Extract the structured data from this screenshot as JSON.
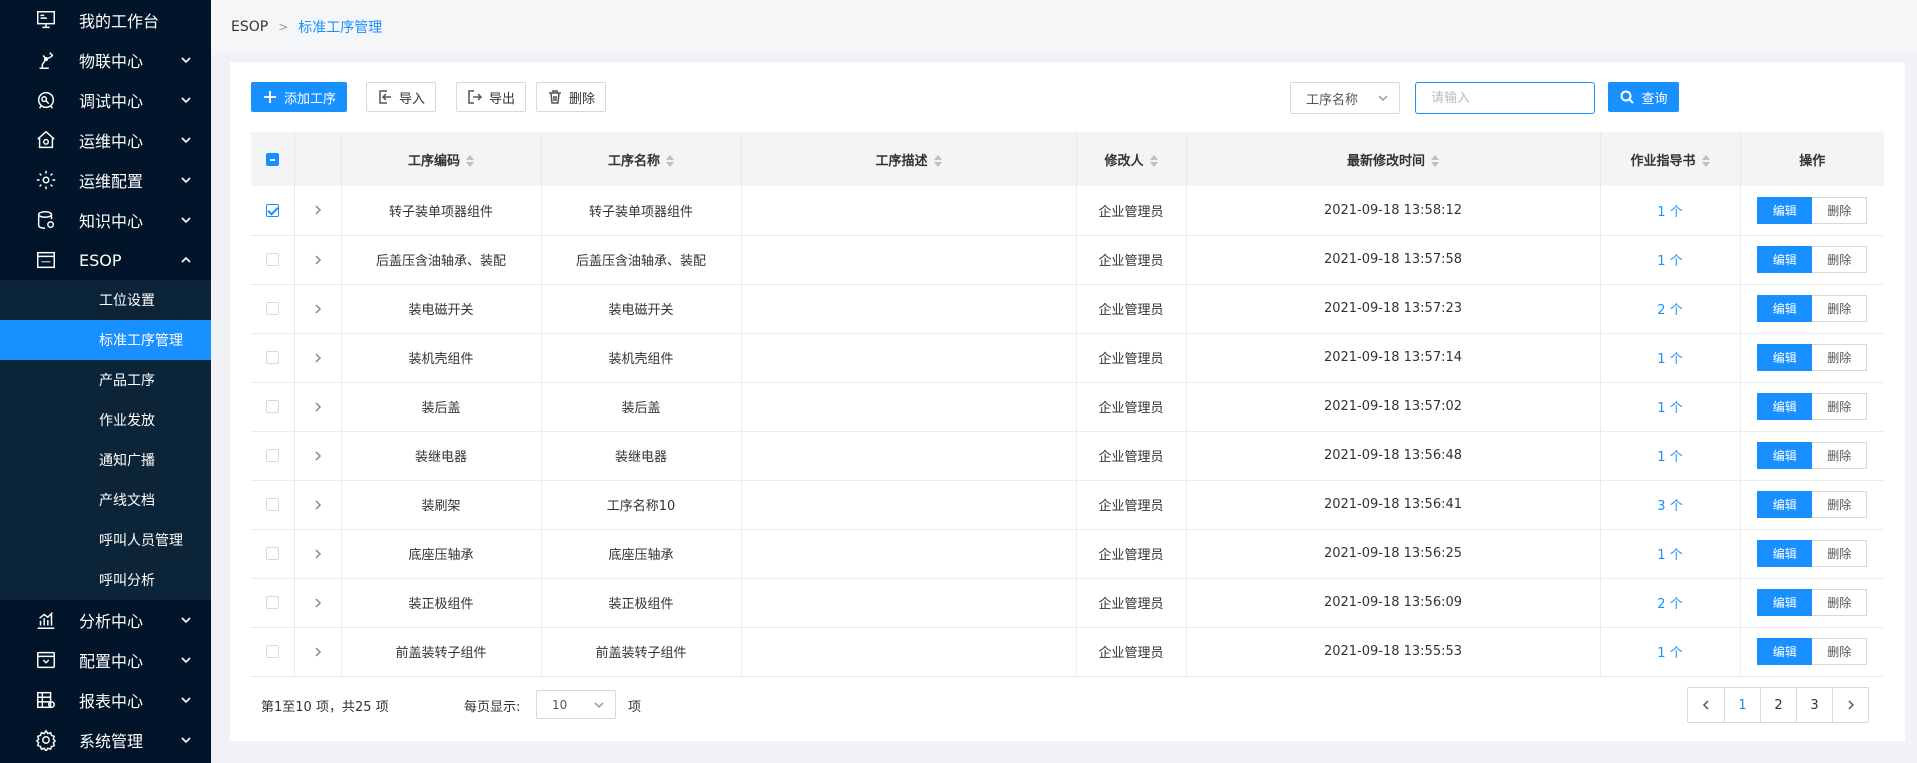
{
  "sidebar": {
    "items": [
      {
        "label": "我的工作台",
        "icon": "monitor-icon",
        "has_arrow": false
      },
      {
        "label": "物联中心",
        "icon": "robot-arm-icon",
        "has_arrow": true
      },
      {
        "label": "调试中心",
        "icon": "debug-icon",
        "has_arrow": true
      },
      {
        "label": "运维中心",
        "icon": "home-gear-icon",
        "has_arrow": true
      },
      {
        "label": "运维配置",
        "icon": "gear-icon",
        "has_arrow": true
      },
      {
        "label": "知识中心",
        "icon": "database-icon",
        "has_arrow": true
      },
      {
        "label": "ESOP",
        "icon": "esop-icon",
        "has_arrow": true,
        "expanded": true
      }
    ],
    "esop_sub": [
      {
        "label": "工位设置"
      },
      {
        "label": "标准工序管理",
        "active": true
      },
      {
        "label": "产品工序"
      },
      {
        "label": "作业发放"
      },
      {
        "label": "通知广播"
      },
      {
        "label": "产线文档"
      },
      {
        "label": "呼叫人员管理"
      },
      {
        "label": "呼叫分析"
      }
    ],
    "bottom_items": [
      {
        "label": "分析中心",
        "icon": "bar-chart-icon"
      },
      {
        "label": "配置中心",
        "icon": "config-icon"
      },
      {
        "label": "报表中心",
        "icon": "report-icon"
      },
      {
        "label": "系统管理",
        "icon": "settings-icon"
      }
    ]
  },
  "breadcrumb": {
    "root": "ESOP",
    "current": "标准工序管理"
  },
  "toolbar": {
    "add_label": "添加工序",
    "import_label": "导入",
    "export_label": "导出",
    "delete_label": "删除",
    "filter_field": "工序名称",
    "search_placeholder": "请输入",
    "query_label": "查询"
  },
  "table": {
    "headers": {
      "code": "工序编码",
      "name": "工序名称",
      "desc": "工序描述",
      "modifier": "修改人",
      "time": "最新修改时间",
      "guide": "作业指导书",
      "ops": "操作"
    },
    "edit_label": "编辑",
    "delete_label": "删除",
    "rows": [
      {
        "checked": true,
        "code": "转子装单项器组件",
        "name": "转子装单项器组件",
        "desc": "",
        "modifier": "企业管理员",
        "time": "2021-09-18 13:58:12",
        "guide": "1 个"
      },
      {
        "checked": false,
        "code": "后盖压含油轴承、装配",
        "name": "后盖压含油轴承、装配",
        "desc": "",
        "modifier": "企业管理员",
        "time": "2021-09-18 13:57:58",
        "guide": "1 个"
      },
      {
        "checked": false,
        "code": "装电磁开关",
        "name": "装电磁开关",
        "desc": "",
        "modifier": "企业管理员",
        "time": "2021-09-18 13:57:23",
        "guide": "2 个"
      },
      {
        "checked": false,
        "code": "装机壳组件",
        "name": "装机壳组件",
        "desc": "",
        "modifier": "企业管理员",
        "time": "2021-09-18 13:57:14",
        "guide": "1 个"
      },
      {
        "checked": false,
        "code": "装后盖",
        "name": "装后盖",
        "desc": "",
        "modifier": "企业管理员",
        "time": "2021-09-18 13:57:02",
        "guide": "1 个"
      },
      {
        "checked": false,
        "code": "装继电器",
        "name": "装继电器",
        "desc": "",
        "modifier": "企业管理员",
        "time": "2021-09-18 13:56:48",
        "guide": "1 个"
      },
      {
        "checked": false,
        "code": "装刷架",
        "name": "工序名称10",
        "desc": "",
        "modifier": "企业管理员",
        "time": "2021-09-18 13:56:41",
        "guide": "3 个"
      },
      {
        "checked": false,
        "code": "底座压轴承",
        "name": "底座压轴承",
        "desc": "",
        "modifier": "企业管理员",
        "time": "2021-09-18 13:56:25",
        "guide": "1 个"
      },
      {
        "checked": false,
        "code": "装正极组件",
        "name": "装正极组件",
        "desc": "",
        "modifier": "企业管理员",
        "time": "2021-09-18 13:56:09",
        "guide": "2 个"
      },
      {
        "checked": false,
        "code": "前盖装转子组件",
        "name": "前盖装转子组件",
        "desc": "",
        "modifier": "企业管理员",
        "time": "2021-09-18 13:55:53",
        "guide": "1 个"
      }
    ]
  },
  "footer": {
    "summary": "第1至10 项，共25  项",
    "per_page_label": "每页显示:",
    "per_page_value": "10",
    "per_page_unit": "项",
    "pages": [
      "1",
      "2",
      "3"
    ],
    "current_page": "1"
  },
  "colors": {
    "sidebar_bg": "#001529",
    "accent": "#1890ff"
  }
}
